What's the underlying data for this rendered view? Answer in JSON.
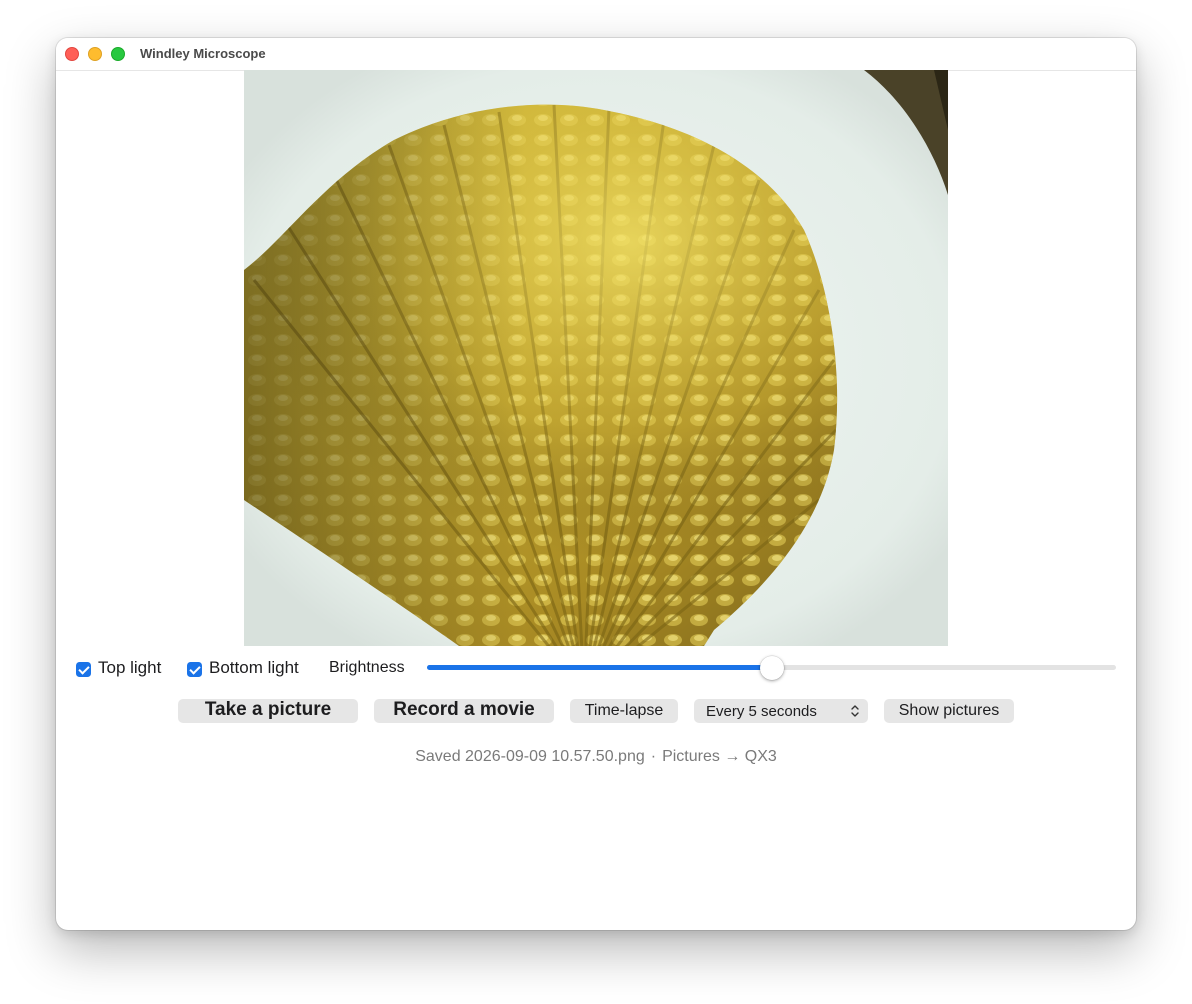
{
  "window": {
    "title": "Windley Microscope"
  },
  "controls": {
    "top_light": {
      "label": "Top light",
      "checked": true
    },
    "bottom_light": {
      "label": "Bottom light",
      "checked": true
    },
    "brightness": {
      "label": "Brightness",
      "value": 0.5
    }
  },
  "buttons": {
    "take_picture": "Take a picture",
    "record_movie": "Record a movie",
    "time_lapse": "Time-lapse",
    "interval": {
      "selected": "Every 5 seconds"
    },
    "show_pictures": "Show pictures"
  },
  "status": {
    "saved": "Saved 2026-09-09 10.57.50.png",
    "separator": "·",
    "location": "Pictures → QX3"
  },
  "icons": {
    "close": "close-icon",
    "minimize": "minimize-icon",
    "maximize": "maximize-icon",
    "select_chevron": "chevron-up-down-icon"
  },
  "colors": {
    "accent": "#1a73e8",
    "close": "#ff5f57",
    "minimize": "#febc2e",
    "maximize": "#28c840"
  }
}
